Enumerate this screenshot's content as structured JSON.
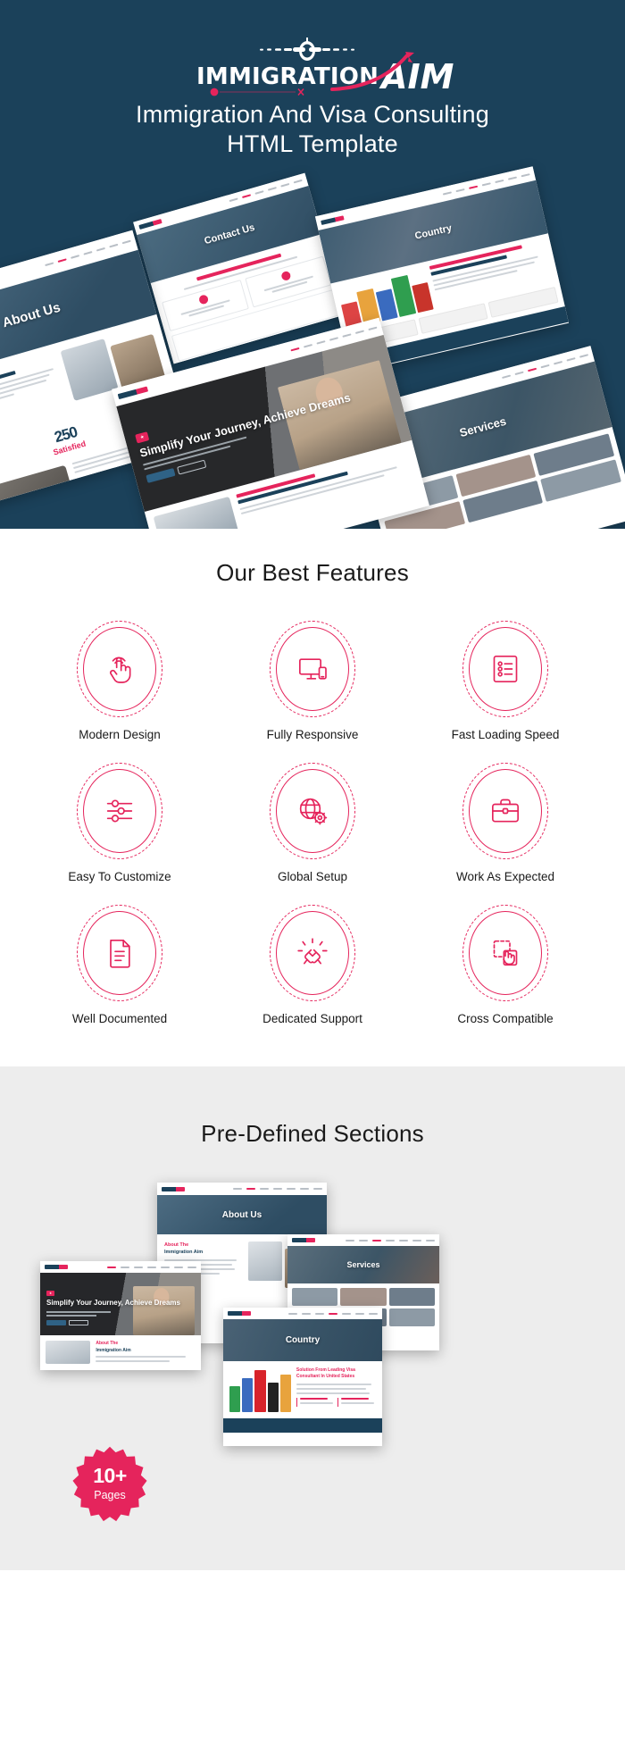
{
  "theme": {
    "dark_blue": "#1b415a",
    "accent_pink": "#e5245c",
    "gray_section": "#ededed",
    "white": "#ffffff"
  },
  "hero": {
    "logo": {
      "word_mark": "IMMIGRATION",
      "accent_mark": "AIM",
      "plane_icon": "airplane-icon",
      "swoosh_icon": "swoosh-icon"
    },
    "title_line1": "Immigration And Visa Consulting",
    "title_line2": "HTML Template",
    "mockups": [
      {
        "name": "contact-us",
        "hero_title": "Contact Us"
      },
      {
        "name": "country",
        "hero_title": "Country"
      },
      {
        "name": "about-us",
        "hero_title": "About Us"
      },
      {
        "name": "home",
        "hero_title": "Simplify Your Journey, Achieve Dreams"
      },
      {
        "name": "services",
        "hero_title": "Services"
      }
    ]
  },
  "features": {
    "title": "Our Best Features",
    "items": [
      {
        "icon": "touch-pointer-icon",
        "label": "Modern Design"
      },
      {
        "icon": "responsive-devices-icon",
        "label": "Fully Responsive"
      },
      {
        "icon": "checklist-icon",
        "label": "Fast Loading Speed"
      },
      {
        "icon": "sliders-icon",
        "label": "Easy To Customize"
      },
      {
        "icon": "globe-gear-icon",
        "label": "Global Setup"
      },
      {
        "icon": "briefcase-icon",
        "label": "Work As Expected"
      },
      {
        "icon": "document-icon",
        "label": "Well Documented"
      },
      {
        "icon": "handshake-icon",
        "label": "Dedicated Support"
      },
      {
        "icon": "cross-compatible-icon",
        "label": "Cross Compatible"
      }
    ]
  },
  "predefined": {
    "title": "Pre-Defined Sections",
    "mockups": [
      {
        "name": "about-us",
        "hero_title": "About Us",
        "sub_heading_a": "About The",
        "sub_heading_b": "Immigration Aim"
      },
      {
        "name": "services",
        "hero_title": "Services"
      },
      {
        "name": "home",
        "hero_title": "Simplify Your Journey, Achieve Dreams",
        "sub_heading_a": "About The",
        "sub_heading_b": "Immigration Aim"
      },
      {
        "name": "country",
        "hero_title": "Country",
        "body_heading": "Solution From Leading Visa Consultant In United States"
      }
    ],
    "badge": {
      "count": "10+",
      "unit": "Pages"
    }
  }
}
